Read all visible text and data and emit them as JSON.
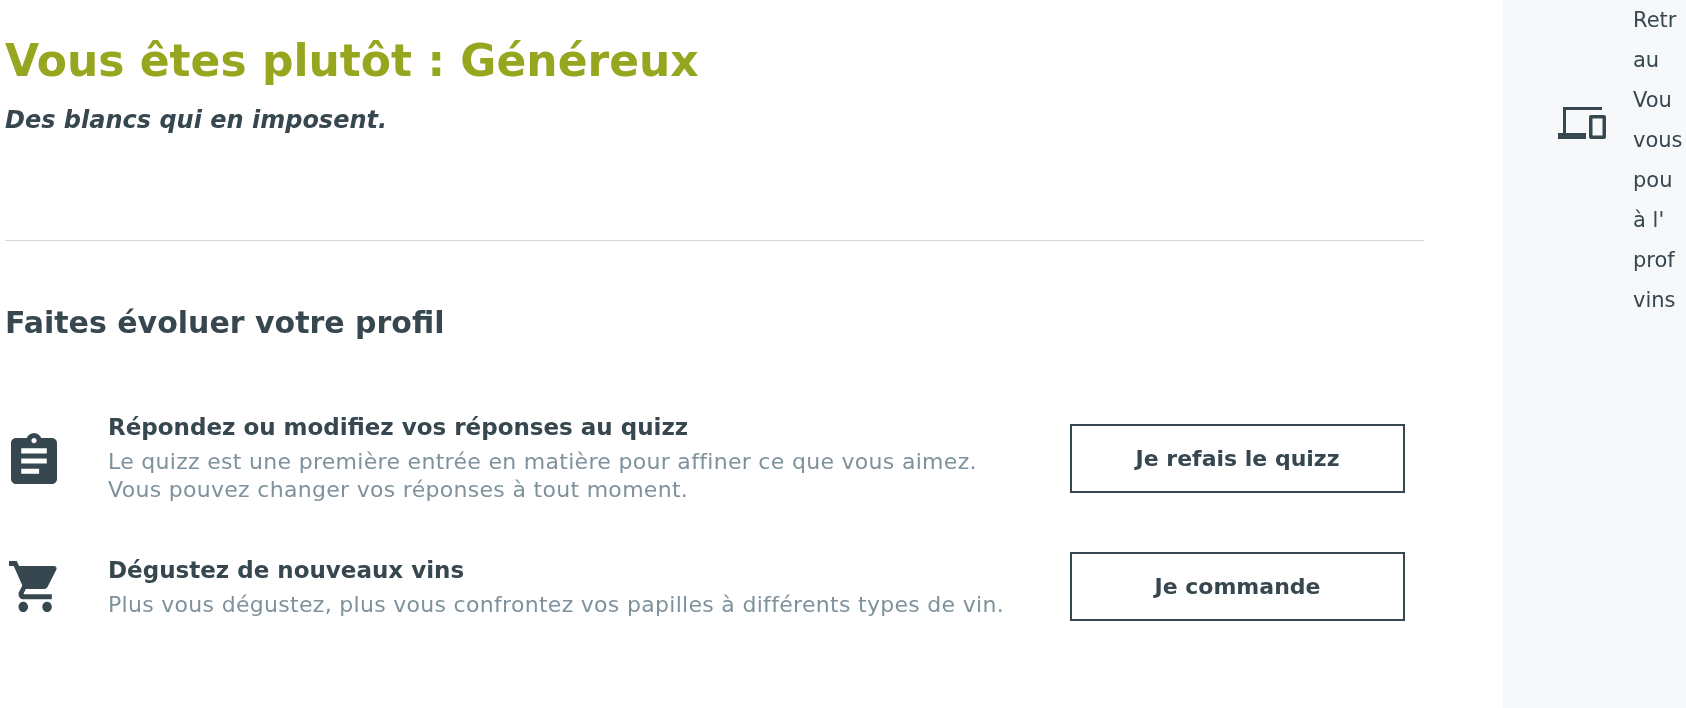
{
  "result": {
    "title": "Vous êtes plutôt : Généreux",
    "tagline": "Des blancs qui en imposent."
  },
  "evolve_section": {
    "heading": "Faites évoluer votre profil",
    "actions": [
      {
        "kind": "quiz",
        "title": "Répondez ou modifiez vos réponses au quizz",
        "description": [
          "Le quizz est une première entrée en matière pour affiner ce que vous aimez.",
          "Vous pouvez changer vos réponses à tout moment."
        ],
        "button": "Je refais le quizz"
      },
      {
        "kind": "order",
        "title": "Dégustez de nouveaux vins",
        "description": [
          "Plus vous dégustez, plus vous confrontez vos papilles à différents types de vin."
        ],
        "button": "Je commande"
      }
    ]
  },
  "side_panel": {
    "text_lines": [
      "Retr",
      "au",
      "Vou",
      "vous",
      "pou",
      "à l'",
      "prof",
      "vins"
    ]
  }
}
